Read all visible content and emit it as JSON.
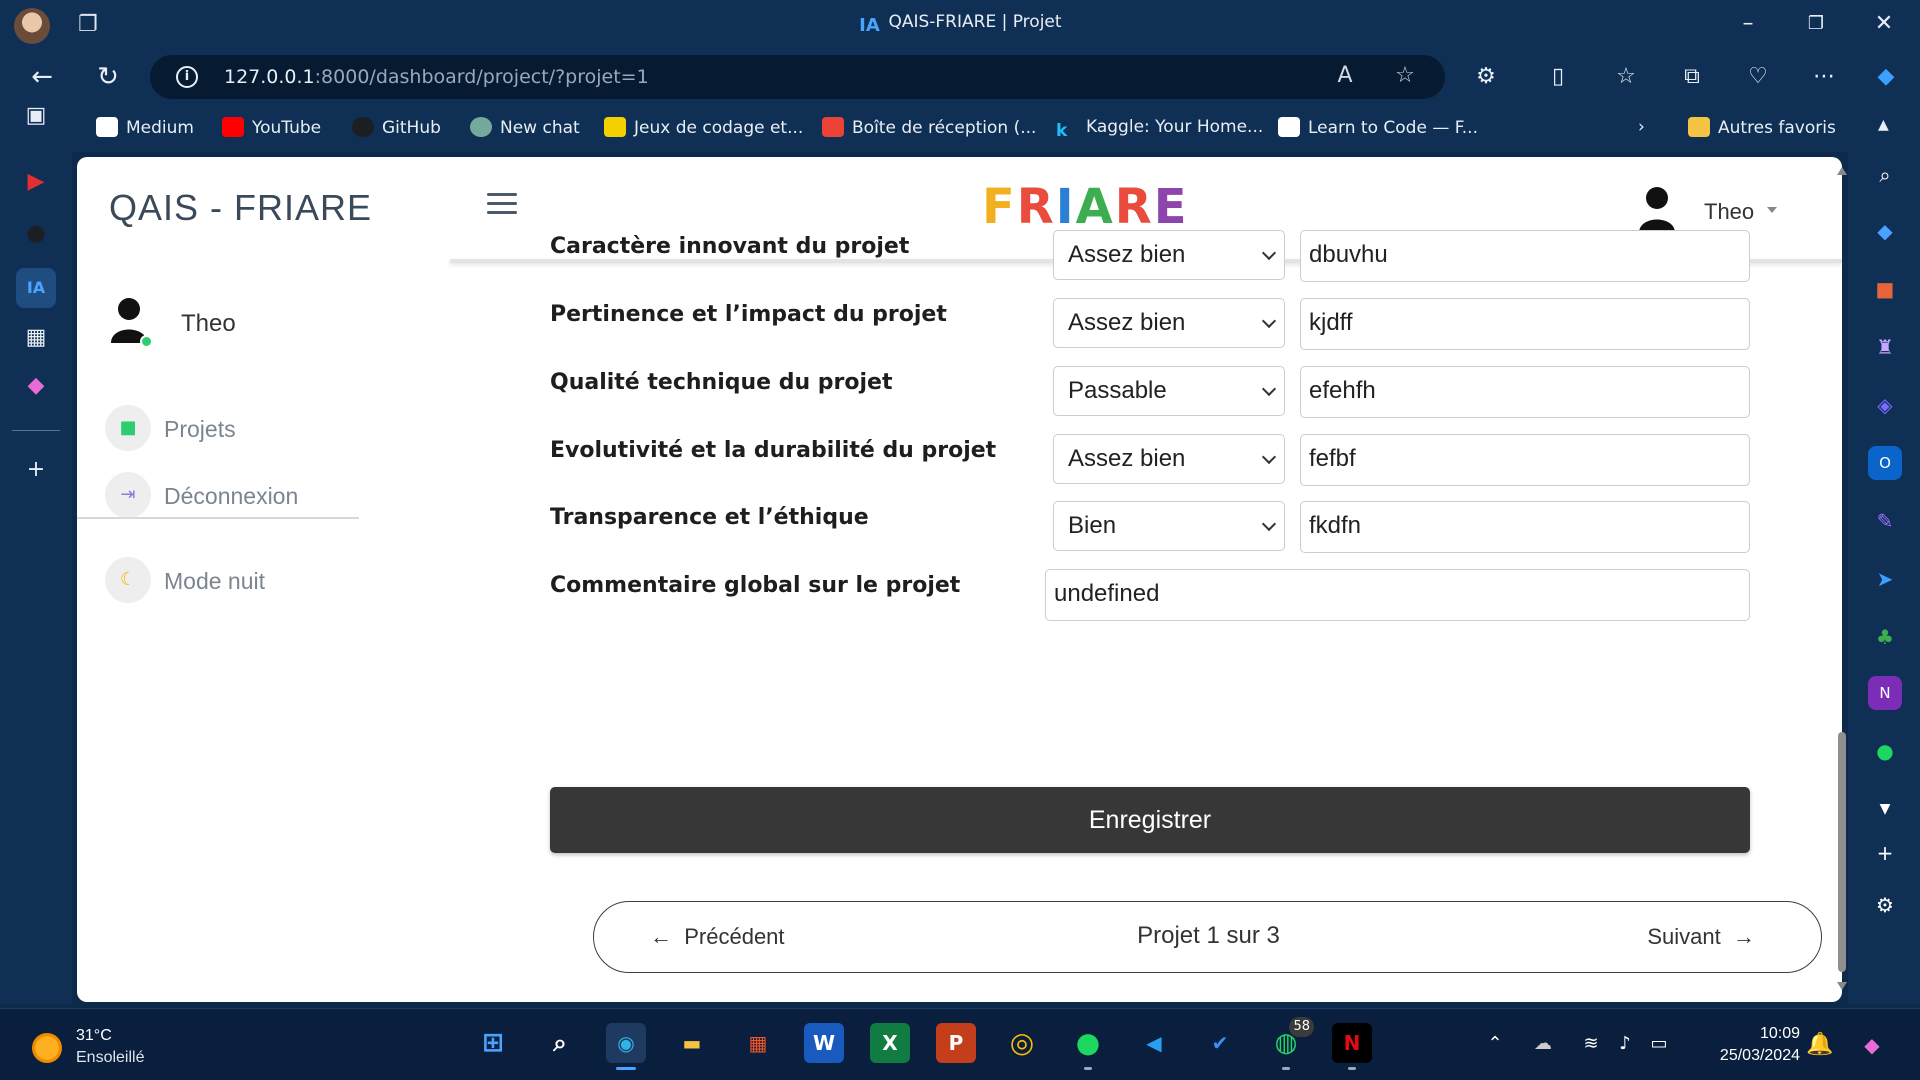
{
  "browser": {
    "window_title": "QAIS-FRIARE | Projet",
    "url_host": "127.0.0.1",
    "url_path": ":8000/dashboard/project/?projet=1",
    "bookmarks": [
      "Medium",
      "YouTube",
      "GitHub",
      "New chat",
      "Jeux de codage et...",
      "Boîte de réception (...",
      "Kaggle: Your Home...",
      "Learn to Code — F..."
    ],
    "other_favorites": "Autres favoris"
  },
  "app": {
    "brand": "QAIS - FRIARE",
    "logo_letters": [
      "F",
      "R",
      "I",
      "A",
      "R",
      "E"
    ],
    "top_user": "Theo"
  },
  "sidebar": {
    "user_name": "Theo",
    "items": [
      {
        "label": "Projets",
        "icon": "briefcase-icon"
      },
      {
        "label": "Déconnexion",
        "icon": "logout-icon"
      },
      {
        "label": "Mode nuit",
        "icon": "moon-icon"
      }
    ]
  },
  "form": {
    "criteria": [
      {
        "label": "Caractère innovant du projet",
        "rating": "Assez bien",
        "comment": "dbuvhu"
      },
      {
        "label": "Pertinence et l’impact du projet",
        "rating": "Assez bien",
        "comment": "kjdff"
      },
      {
        "label": "Qualité technique du projet",
        "rating": "Passable",
        "comment": "efehfh"
      },
      {
        "label": "Evolutivité et la durabilité du projet",
        "rating": "Assez bien",
        "comment": "fefbf"
      },
      {
        "label": "Transparence et l’éthique",
        "rating": "Bien",
        "comment": "fkdfn"
      }
    ],
    "global_comment_label": "Commentaire global sur le projet",
    "global_comment_value": "undefined",
    "save_label": "Enregistrer"
  },
  "pager": {
    "prev_label": "Précédent",
    "position_label": "Projet 1 sur 3",
    "next_label": "Suivant"
  },
  "taskbar": {
    "temperature": "31°C",
    "condition": "Ensoleillé",
    "whatsapp_badge": "58",
    "time": "10:09",
    "date": "25/03/2024"
  }
}
